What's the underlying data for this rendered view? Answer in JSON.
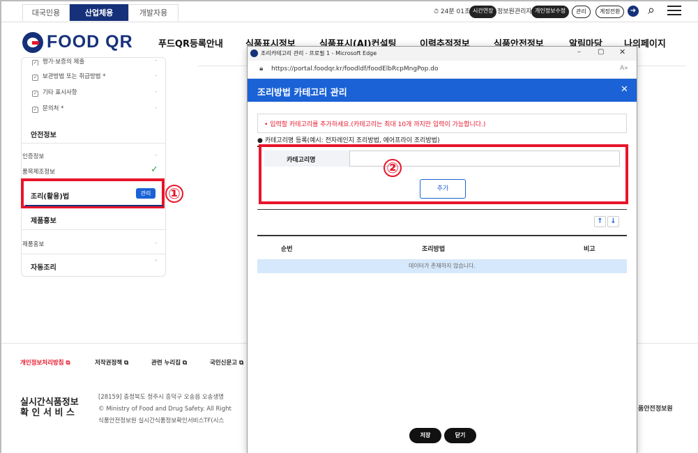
{
  "top_tabs": [
    "대국민용",
    "산업체용",
    "개발자용"
  ],
  "session": {
    "timer": "24분 01초",
    "extend_button": "시간연장",
    "admin_label": "정보원관리자",
    "edit_info_button": "개인정보수정",
    "manage_button": "관리",
    "switch_account_button": "계정전환"
  },
  "brand": {
    "logo_text": "FOOD QR",
    "accent_color": "#16317a"
  },
  "nav": [
    "푸드QR등록안내",
    "식품표시정보",
    "식품표시(AI)컨설팅",
    "이력추적정보",
    "식품안전정보",
    "알림마당",
    "나의페이지"
  ],
  "sidebar": {
    "checklist": [
      {
        "label": "평가·보증의 제출",
        "value": "-"
      },
      {
        "label": "보관방법 또는 취급방법 *",
        "value": "-"
      },
      {
        "label": "기타 표시사항",
        "value": "-"
      },
      {
        "label": "문의처 *",
        "value": "-"
      }
    ],
    "section_safety": "안전정보",
    "safety_items": [
      {
        "label": "인증정보",
        "value": "-"
      },
      {
        "label": "품목제조정보",
        "value": "✓"
      }
    ],
    "cooking_section": "조리(활용)법",
    "manage_button": "관리",
    "section_promo": "제품홍보",
    "promo_items": [
      {
        "label": "제품홍보",
        "value": "-"
      }
    ],
    "section_auto": "자동조리"
  },
  "annotations": {
    "one": "①",
    "two": "②"
  },
  "popup": {
    "window_title": "조리카테고리 관리 - 프로필 1 - Microsoft Edge",
    "url": "https://portal.foodqr.kr/foodldf/foodElbRcpMngPop.do",
    "title": "조리방법 카테고리 관리",
    "notice": "입력할 카테고리를 추가하세요.(카테고리는 최대 10개 까지만 입력이 가능합니다.)",
    "register_label": "카테고리명 등록(예시: 전자레인지 조리방법, 에어프라이 조리방법)",
    "field_label": "카테고리명",
    "field_value": "",
    "add_button": "추가",
    "table_headers": [
      "순번",
      "조리방법",
      "비고"
    ],
    "empty_row": "데이터가 존재하지 않습니다.",
    "save_button": "저장",
    "close_button": "닫기"
  },
  "footer": {
    "links": [
      "개인정보처리방침",
      "저작권정책",
      "관련 누리집",
      "국민신문고"
    ],
    "service_name_line1": "실시간식품정보",
    "service_name_line2": "확 인 서 비 스",
    "address": "[28159] 충청북도 청주시 흥덕구 오송읍 오송생명",
    "copyright": "© Ministry of Food and Drug Safety. All Right",
    "org": "식품안전정보원 실시간식품정보확인서비스TF(시스",
    "right_org": "품안전정보원"
  }
}
